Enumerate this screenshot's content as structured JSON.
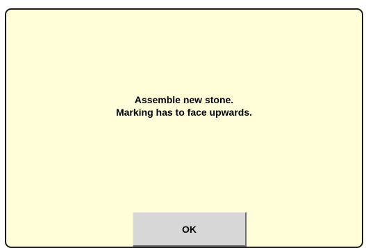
{
  "dialog": {
    "message_line1": "Assemble new stone.",
    "message_line2": "Marking has to face upwards.",
    "ok_label": "OK"
  },
  "colors": {
    "dialog_background": "#fffed8",
    "border": "#1a1a1a",
    "button_face": "#d7d7d7"
  }
}
